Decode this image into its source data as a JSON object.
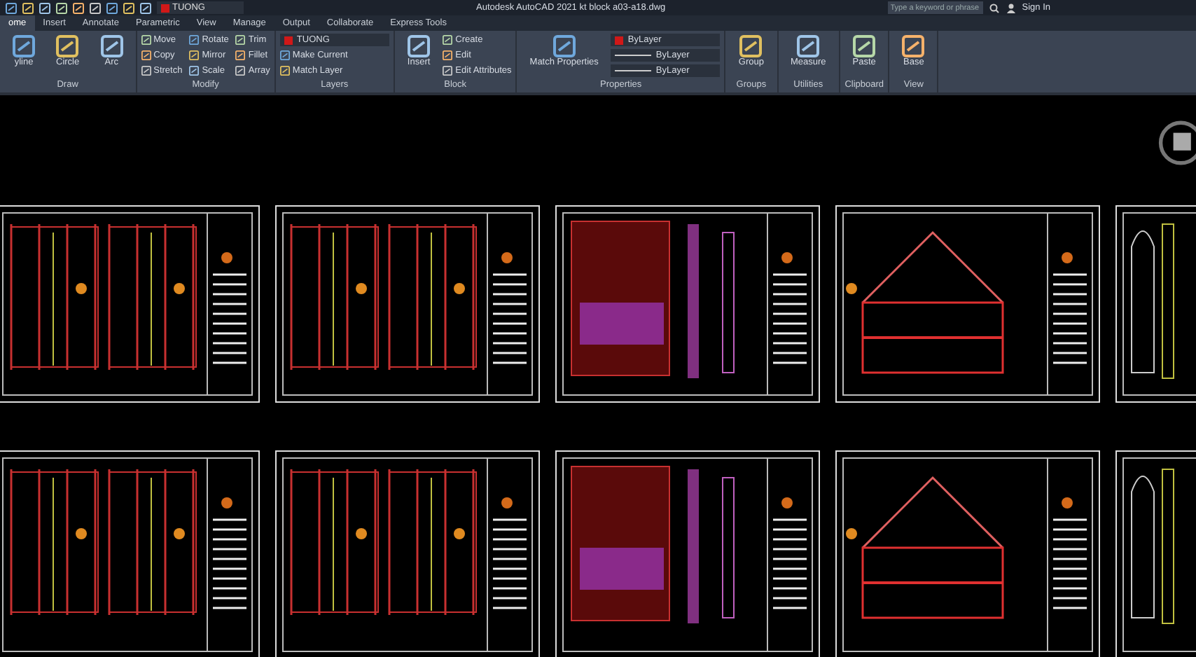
{
  "title_bar": {
    "layer": "TUONG",
    "app": "Autodesk AutoCAD 2021",
    "file": "kt block a03-a18.dwg",
    "search": {
      "placeholder": "Type a keyword or phrase"
    },
    "sign_in": "Sign In"
  },
  "tabs": [
    {
      "label": "ome",
      "selected": true
    },
    {
      "label": "Insert",
      "selected": false
    },
    {
      "label": "Annotate",
      "selected": false
    },
    {
      "label": "Parametric",
      "selected": false
    },
    {
      "label": "View",
      "selected": false
    },
    {
      "label": "Manage",
      "selected": false
    },
    {
      "label": "Output",
      "selected": false
    },
    {
      "label": "Collaborate",
      "selected": false
    },
    {
      "label": "Express Tools",
      "selected": false
    }
  ],
  "panels": [
    {
      "title": "Draw",
      "items": [
        {
          "kind": "large",
          "label": "yline"
        },
        {
          "kind": "large",
          "label": "Circle"
        },
        {
          "kind": "large",
          "label": "Arc"
        }
      ]
    },
    {
      "title": "Modify",
      "items": [
        {
          "kind": "small",
          "label": "Move"
        },
        {
          "kind": "small",
          "label": "Copy"
        },
        {
          "kind": "small",
          "label": "Stretch"
        },
        {
          "kind": "small",
          "label": "Rotate"
        },
        {
          "kind": "small",
          "label": "Mirror"
        },
        {
          "kind": "small",
          "label": "Scale"
        },
        {
          "kind": "small",
          "label": "Trim"
        },
        {
          "kind": "small",
          "label": "Fillet"
        },
        {
          "kind": "small",
          "label": "Array"
        }
      ]
    },
    {
      "title": "Layers",
      "items": [
        {
          "kind": "layer-dropdown",
          "label": "TUONG"
        },
        {
          "kind": "small",
          "label": "Make Current"
        },
        {
          "kind": "small",
          "label": "Match Layer"
        }
      ]
    },
    {
      "title": "Block",
      "items": [
        {
          "kind": "large",
          "label": "Insert"
        },
        {
          "kind": "small",
          "label": "Create"
        },
        {
          "kind": "small",
          "label": "Edit"
        },
        {
          "kind": "small",
          "label": "Edit Attributes"
        }
      ]
    },
    {
      "title": "Properties",
      "items": [
        {
          "kind": "large",
          "label": "Match Properties"
        },
        {
          "kind": "color-dropdown",
          "label": "ByLayer"
        },
        {
          "kind": "line-dropdown",
          "label": "ByLayer"
        },
        {
          "kind": "line-dropdown",
          "label": "ByLayer"
        }
      ]
    },
    {
      "title": "Groups",
      "items": [
        {
          "kind": "large",
          "label": "Group"
        }
      ]
    },
    {
      "title": "Utilities",
      "items": [
        {
          "kind": "large",
          "label": "Measure"
        }
      ]
    },
    {
      "title": "Clipboard",
      "items": [
        {
          "kind": "large",
          "label": "Paste"
        }
      ]
    },
    {
      "title": "View",
      "items": [
        {
          "kind": "large",
          "label": "Base"
        }
      ]
    }
  ]
}
